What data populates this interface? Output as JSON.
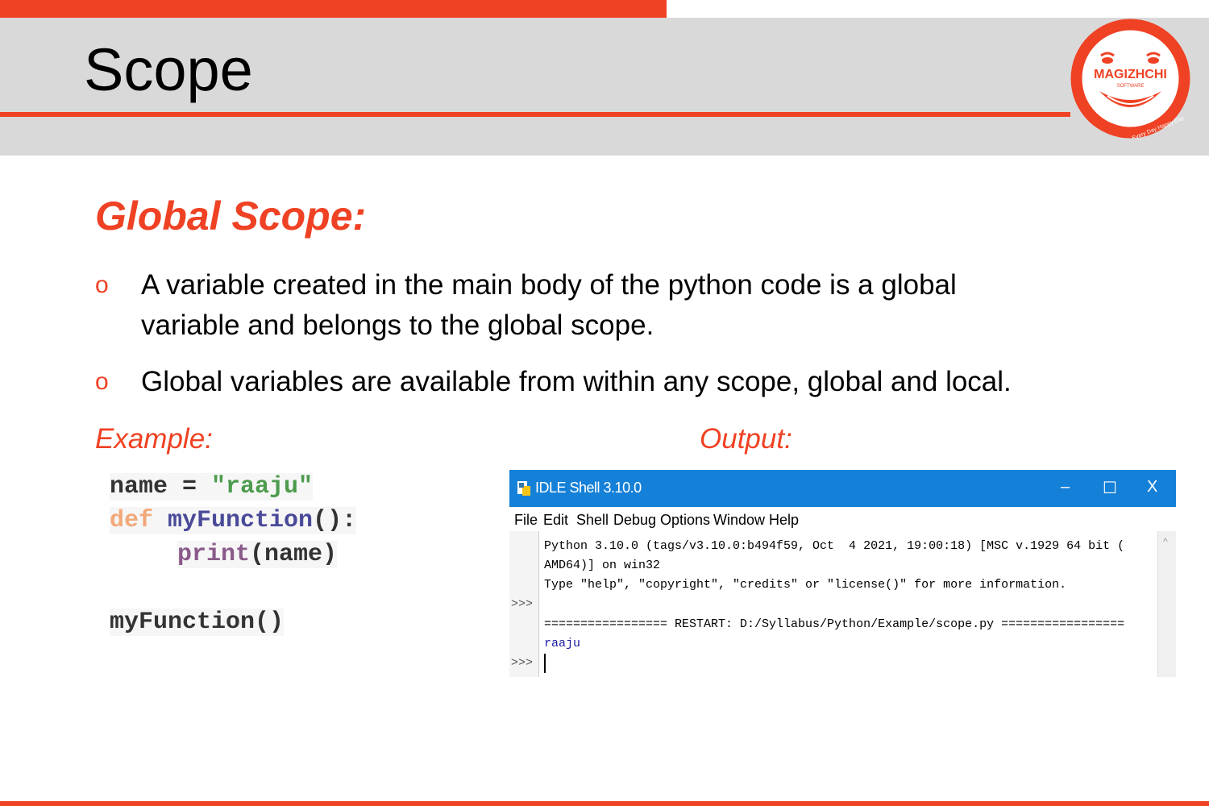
{
  "slide": {
    "title": "Scope"
  },
  "logo": {
    "name": "MAGIZHCHI",
    "sub": "SOFTWARE",
    "tagline": "Every Day Happy Day"
  },
  "section": {
    "heading": "Global Scope:"
  },
  "bullets": [
    {
      "marker": "o",
      "line1": "A variable created in the main body of the python code is a global",
      "line2": "variable and belongs to the global scope."
    },
    {
      "marker": "o",
      "line1": "Global variables are available from within any scope, global and local."
    }
  ],
  "example": {
    "label": "Example:",
    "code": {
      "l1_a": "name = ",
      "l1_b": "\"raaju\"",
      "l2_a": "def",
      "l2_b": " myFunction",
      "l2_c": "():",
      "l3_a": "print",
      "l3_b": "(name)",
      "l4": "myFunction()"
    }
  },
  "output": {
    "label": "Output:",
    "window": {
      "title": "IDLE Shell 3.10.0",
      "controls": {
        "minimize": "–",
        "maximize": "☐",
        "close": "X"
      },
      "menu": [
        "File",
        "Edit",
        "Shell",
        "Debug",
        "Options",
        "Window",
        "Help"
      ],
      "prompts": [
        ">>>",
        ">>>"
      ],
      "lines": [
        "Python 3.10.0 (tags/v3.10.0:b494f59, Oct  4 2021, 19:00:18) [MSC v.1929 64 bit (",
        "AMD64)] on win32",
        "Type \"help\", \"copyright\", \"credits\" or \"license()\" for more information.",
        "================= RESTART: D:/Syllabus/Python/Example/scope.py =================",
        "raaju"
      ],
      "scroll_arrow": "^"
    }
  },
  "colors": {
    "accent": "#ef4123",
    "header_bg": "#d9d9d9",
    "idle_title": "#1580d8"
  }
}
